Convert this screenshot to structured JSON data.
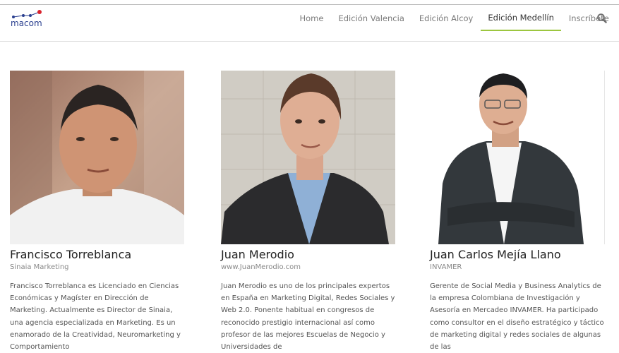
{
  "brand": {
    "logo_text": "macom",
    "accent": "#9cc63f",
    "logo_color": "#2a3f8f",
    "dot_red": "#d9232d"
  },
  "nav": {
    "items": [
      {
        "label": "Home",
        "active": false
      },
      {
        "label": "Edición Valencia",
        "active": false
      },
      {
        "label": "Edición Alcoy",
        "active": false
      },
      {
        "label": "Edición Medellín",
        "active": true
      },
      {
        "label": "Inscríbete",
        "active": false
      }
    ],
    "search_icon": "search-icon"
  },
  "speakers": [
    {
      "name": "Francisco Torreblanca",
      "company": "Sinaia Marketing",
      "bio": "Francisco Torreblanca es Licenciado en Ciencias Económicas y Magíster en Dirección de Marketing. Actualmente es Director de Sinaia, una agencia especializada en Marketing. Es un enamorado de la Creatividad, Neuromarketing y Comportamiento"
    },
    {
      "name": "Juan Merodio",
      "company": "www.JuanMerodio.com",
      "bio": "Juan Merodio es uno de los principales expertos en España en Marketing Digital, Redes Sociales y Web 2.0. Ponente habitual en congresos de reconocido prestigio internacional así como profesor de las mejores Escuelas de Negocio y Universidades de"
    },
    {
      "name": "Juan Carlos Mejía Llano",
      "company": "INVAMER",
      "bio": "Gerente de Social Media y Business Analytics de la empresa Colombiana de Investigación y Asesoría en Mercadeo INVAMER. Ha participado como consultor en el diseño estratégico y táctico de marketing digital y redes sociales de algunas de las"
    }
  ]
}
